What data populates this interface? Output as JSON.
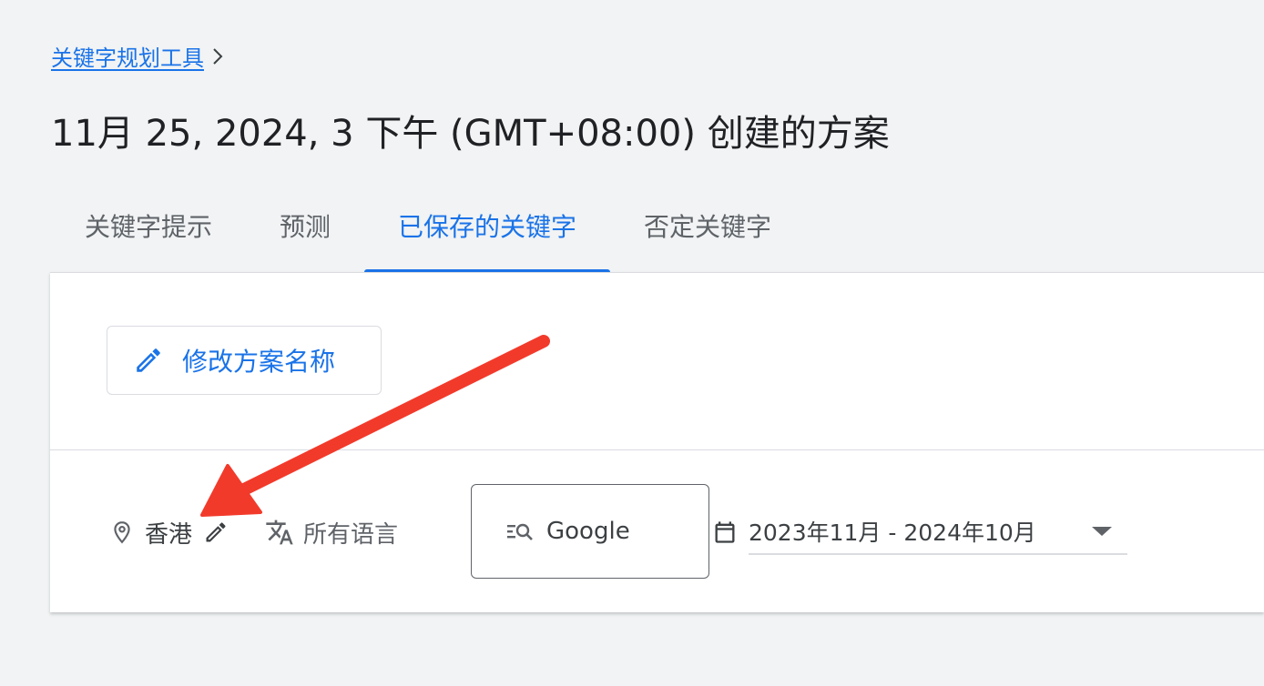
{
  "breadcrumb": {
    "link_label": "关键字规划工具"
  },
  "page": {
    "title": "11月 25, 2024, 3 下午 (GMT+08:00) 创建的方案"
  },
  "tabs": [
    {
      "label": "关键字提示",
      "active": false
    },
    {
      "label": "预测",
      "active": false
    },
    {
      "label": "已保存的关键字",
      "active": true
    },
    {
      "label": "否定关键字",
      "active": false
    }
  ],
  "plan": {
    "rename_label": "修改方案名称"
  },
  "filters": {
    "location": "香港",
    "language": "所有语言",
    "network": "Google",
    "date_range": "2023年11月 - 2024年10月"
  },
  "colors": {
    "accent": "#1a73e8",
    "annotation_arrow": "#f23a2b",
    "background": "#f1f3f4"
  },
  "icons": {
    "breadcrumb": "chevron-right-icon",
    "rename": "pencil-icon",
    "location": "location-pin-icon",
    "location_edit": "pencil-icon",
    "language": "translate-icon",
    "network": "search-network-icon",
    "date": "calendar-icon",
    "dropdown": "dropdown-arrow-icon"
  }
}
